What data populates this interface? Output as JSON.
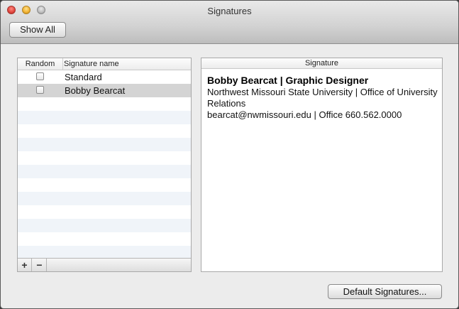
{
  "window": {
    "title": "Signatures",
    "show_all_label": "Show All"
  },
  "list": {
    "header_random": "Random",
    "header_name": "Signature name",
    "rows": [
      {
        "label": "Standard",
        "checked": false,
        "selected": false
      },
      {
        "label": "Bobby Bearcat",
        "checked": false,
        "selected": true
      }
    ],
    "footer": {
      "add_label": "+",
      "remove_label": "−"
    }
  },
  "signature": {
    "header": "Signature",
    "title": "Bobby Bearcat | Graphic Designer",
    "line1": "Northwest Missouri State University  |  Office of University Relations",
    "line2": "bearcat@nwmissouri.edu  |  Office 660.562.0000"
  },
  "footer": {
    "default_signatures_label": "Default Signatures..."
  }
}
